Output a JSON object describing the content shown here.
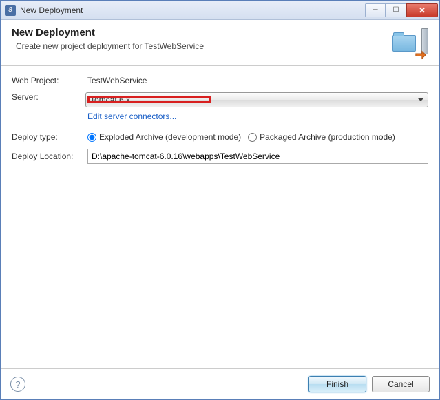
{
  "window": {
    "title": "New Deployment"
  },
  "header": {
    "title": "New Deployment",
    "subtitle": "Create new project deployment for TestWebService"
  },
  "form": {
    "web_project_label": "Web Project:",
    "web_project_value": "TestWebService",
    "server_label": "Server:",
    "server_value": "Tomcat  6.x",
    "edit_connectors": "Edit server connectors...",
    "deploy_type_label": "Deploy type:",
    "deploy_type_options": {
      "exploded": "Exploded Archive (development mode)",
      "packaged": "Packaged Archive (production mode)"
    },
    "deploy_location_label": "Deploy Location:",
    "deploy_location_value": "D:\\apache-tomcat-6.0.16\\webapps\\TestWebService"
  },
  "footer": {
    "finish": "Finish",
    "cancel": "Cancel"
  }
}
